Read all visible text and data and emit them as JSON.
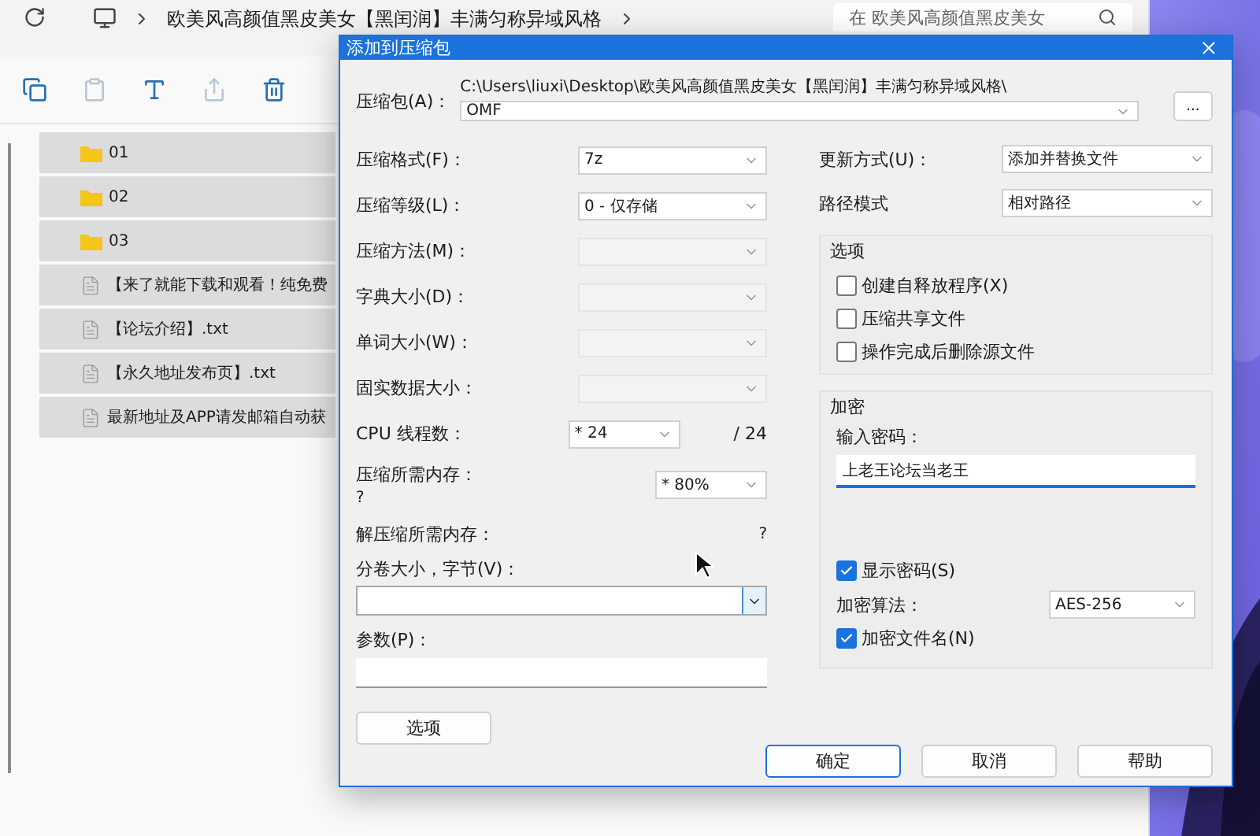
{
  "explorer": {
    "breadcrumb": "欧美风高颜值黑皮美女【黑闰润】丰满匀称异域风格",
    "search": {
      "placeholder": "在 欧美风高颜值黑皮美女"
    },
    "toolbar": [
      {
        "kind": "copy",
        "disabled": false
      },
      {
        "kind": "paste",
        "disabled": true
      },
      {
        "kind": "rename",
        "disabled": false
      },
      {
        "kind": "share",
        "disabled": true
      },
      {
        "kind": "delete",
        "disabled": false
      }
    ],
    "files": [
      {
        "kind": "folder",
        "name": "01",
        "selected": true
      },
      {
        "kind": "folder",
        "name": "02",
        "selected": true
      },
      {
        "kind": "folder",
        "name": "03",
        "selected": true
      },
      {
        "kind": "file",
        "name": "【来了就能下载和观看！纯免费",
        "selected": true
      },
      {
        "kind": "file",
        "name": "【论坛介绍】.txt",
        "selected": true
      },
      {
        "kind": "file",
        "name": "【永久地址发布页】.txt",
        "selected": true
      },
      {
        "kind": "file",
        "name": "最新地址及APP请发邮箱自动获",
        "selected": true
      }
    ]
  },
  "dialog": {
    "title": "添加到压缩包",
    "archive": {
      "label": "压缩包(A)：",
      "path": "C:\\Users\\liuxi\\Desktop\\欧美风高颜值黑皮美女【黑闰润】丰满匀称异域风格\\",
      "value": "OMF",
      "browse": "..."
    },
    "left_fields": [
      {
        "label": "压缩格式(F)：",
        "value": "7z",
        "disabled": false
      },
      {
        "label": "压缩等级(L)：",
        "value": "0 - 仅存储",
        "disabled": false
      },
      {
        "label": "压缩方法(M)：",
        "disabled": true
      },
      {
        "label": "字典大小(D)：",
        "disabled": true
      },
      {
        "label": "单词大小(W)：",
        "disabled": true
      },
      {
        "label": "固实数据大小：",
        "disabled": true
      }
    ],
    "cpu": {
      "label": "CPU 线程数：",
      "value": "* 24",
      "max": "/ 24"
    },
    "memory": {
      "label": "压缩所需内存：",
      "value": "?",
      "limit": "* 80%"
    },
    "decompress_memory": {
      "label": "解压缩所需内存：",
      "value": "?"
    },
    "volume": {
      "label": "分卷大小，字节(V)："
    },
    "params": {
      "label": "参数(P)："
    },
    "options_button": "选项",
    "right_fields": [
      {
        "label": "更新方式(U)：",
        "value": "添加并替换文件"
      },
      {
        "label": "路径模式",
        "value": "相对路径"
      }
    ],
    "options_group": {
      "title": "选项",
      "items": [
        {
          "label": "创建自释放程序(X)",
          "checked": false
        },
        {
          "label": "压缩共享文件",
          "checked": false
        },
        {
          "label": "操作完成后删除源文件",
          "checked": false
        }
      ]
    },
    "encryption": {
      "title": "加密",
      "password_label": "输入密码：",
      "password": "上老王论坛当老王",
      "show_password": {
        "label": "显示密码(S)",
        "checked": true
      },
      "method_label": "加密算法：",
      "method": "AES-256",
      "encrypt_names": {
        "label": "加密文件名(N)",
        "checked": true
      }
    },
    "buttons": [
      {
        "label": "确定",
        "focused": true
      },
      {
        "label": "取消",
        "focused": false
      },
      {
        "label": "帮助",
        "focused": false
      }
    ]
  }
}
